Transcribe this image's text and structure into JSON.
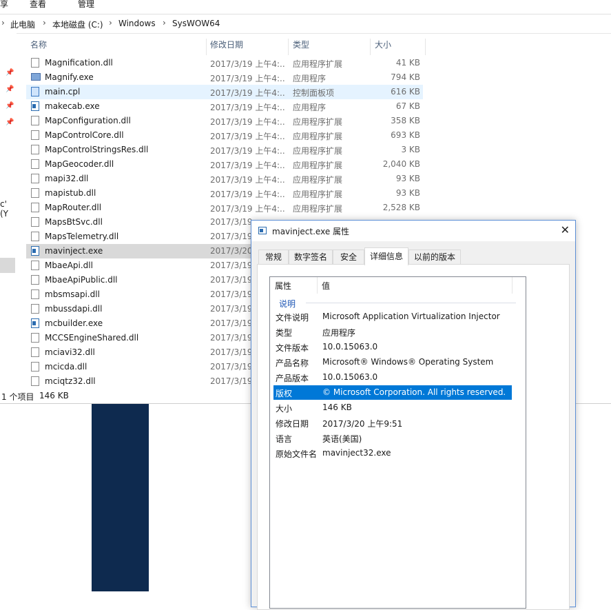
{
  "ribbon": {
    "tabs": [
      "享",
      "查看",
      "管理"
    ]
  },
  "address": {
    "crumbs": [
      "此电脑",
      "本地磁盘 (C:)",
      "Windows",
      "SysWOW64"
    ]
  },
  "nav": {
    "partial_text": "c' (Y"
  },
  "columns": {
    "name": "名称",
    "date": "修改日期",
    "type": "类型",
    "size": "大小"
  },
  "files": [
    {
      "name": "Magnification.dll",
      "date": "2017/3/19 上午4:...",
      "type": "应用程序扩展",
      "size": "41 KB",
      "icon": "dll-icon"
    },
    {
      "name": "Magnify.exe",
      "date": "2017/3/19 上午4:...",
      "type": "应用程序",
      "size": "794 KB",
      "icon": "magnifier-icon"
    },
    {
      "name": "main.cpl",
      "date": "2017/3/19 上午4:...",
      "type": "控制面板项",
      "size": "616 KB",
      "icon": "control-panel-icon"
    },
    {
      "name": "makecab.exe",
      "date": "2017/3/19 上午4:...",
      "type": "应用程序",
      "size": "67 KB",
      "icon": "exe-icon"
    },
    {
      "name": "MapConfiguration.dll",
      "date": "2017/3/19 上午4:...",
      "type": "应用程序扩展",
      "size": "358 KB",
      "icon": "dll-icon"
    },
    {
      "name": "MapControlCore.dll",
      "date": "2017/3/19 上午4:...",
      "type": "应用程序扩展",
      "size": "693 KB",
      "icon": "dll-icon"
    },
    {
      "name": "MapControlStringsRes.dll",
      "date": "2017/3/19 上午4:...",
      "type": "应用程序扩展",
      "size": "3 KB",
      "icon": "dll-icon"
    },
    {
      "name": "MapGeocoder.dll",
      "date": "2017/3/19 上午4:...",
      "type": "应用程序扩展",
      "size": "2,040 KB",
      "icon": "dll-icon"
    },
    {
      "name": "mapi32.dll",
      "date": "2017/3/19 上午4:...",
      "type": "应用程序扩展",
      "size": "93 KB",
      "icon": "dll-icon"
    },
    {
      "name": "mapistub.dll",
      "date": "2017/3/19 上午4:...",
      "type": "应用程序扩展",
      "size": "93 KB",
      "icon": "dll-icon"
    },
    {
      "name": "MapRouter.dll",
      "date": "2017/3/19 上午4:...",
      "type": "应用程序扩展",
      "size": "2,528 KB",
      "icon": "dll-icon"
    },
    {
      "name": "MapsBtSvc.dll",
      "date": "2017/3/19",
      "type": "",
      "size": "",
      "icon": "dll-icon"
    },
    {
      "name": "MapsTelemetry.dll",
      "date": "2017/3/19",
      "type": "",
      "size": "",
      "icon": "dll-icon"
    },
    {
      "name": "mavinject.exe",
      "date": "2017/3/20",
      "type": "",
      "size": "",
      "icon": "exe-icon"
    },
    {
      "name": "MbaeApi.dll",
      "date": "2017/3/19",
      "type": "",
      "size": "",
      "icon": "dll-icon"
    },
    {
      "name": "MbaeApiPublic.dll",
      "date": "2017/3/19",
      "type": "",
      "size": "",
      "icon": "dll-icon"
    },
    {
      "name": "mbsmsapi.dll",
      "date": "2017/3/19",
      "type": "",
      "size": "",
      "icon": "dll-icon"
    },
    {
      "name": "mbussdapi.dll",
      "date": "2017/3/19",
      "type": "",
      "size": "",
      "icon": "dll-icon"
    },
    {
      "name": "mcbuilder.exe",
      "date": "2017/3/19",
      "type": "",
      "size": "",
      "icon": "exe-icon"
    },
    {
      "name": "MCCSEngineShared.dll",
      "date": "2017/3/19",
      "type": "",
      "size": "",
      "icon": "dll-icon"
    },
    {
      "name": "mciavi32.dll",
      "date": "2017/3/19",
      "type": "",
      "size": "",
      "icon": "dll-icon"
    },
    {
      "name": "mcicda.dll",
      "date": "2017/3/19",
      "type": "",
      "size": "",
      "icon": "dll-icon"
    },
    {
      "name": "mciqtz32.dll",
      "date": "2017/3/19",
      "type": "",
      "size": "",
      "icon": "dll-icon"
    }
  ],
  "status": {
    "selected": "1 个项目",
    "size": "146 KB"
  },
  "dialog": {
    "title": "mavinject.exe 属性",
    "tabs": [
      "常规",
      "数字签名",
      "安全",
      "详细信息",
      "以前的版本"
    ],
    "active_tab": "详细信息",
    "list_header": {
      "property": "属性",
      "value": "值"
    },
    "group": "说明",
    "properties": [
      {
        "key": "文件说明",
        "value": "Microsoft Application Virtualization Injector"
      },
      {
        "key": "类型",
        "value": "应用程序"
      },
      {
        "key": "文件版本",
        "value": "10.0.15063.0"
      },
      {
        "key": "产品名称",
        "value": "Microsoft® Windows® Operating System"
      },
      {
        "key": "产品版本",
        "value": "10.0.15063.0"
      },
      {
        "key": "版权",
        "value": "© Microsoft Corporation. All rights reserved."
      },
      {
        "key": "大小",
        "value": "146 KB"
      },
      {
        "key": "修改日期",
        "value": "2017/3/20 上午9:51"
      },
      {
        "key": "语言",
        "value": "英语(美国)"
      },
      {
        "key": "原始文件名",
        "value": "mavinject32.exe"
      }
    ],
    "selected_property": "版权"
  },
  "colors": {
    "selection": "#0078d7",
    "hover": "#e5f3ff",
    "row_selected": "#d9d9d9",
    "desktop": "#0e2a4f"
  }
}
